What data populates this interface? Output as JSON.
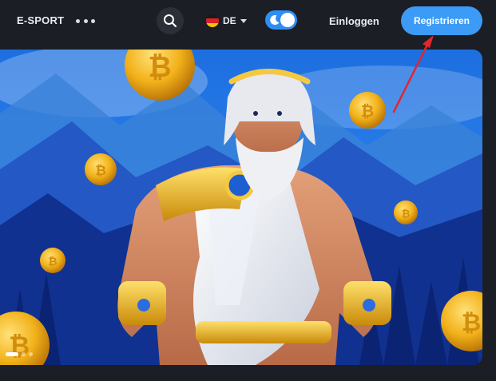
{
  "header": {
    "nav_label": "E-SPORT",
    "more_icon": "more-dots-icon",
    "search_icon": "search-icon",
    "language": {
      "code": "DE",
      "flag": "germany-flag-icon"
    },
    "theme_toggle": {
      "icon": "moon-icon",
      "state": "on"
    },
    "login_label": "Einloggen",
    "register_label": "Registrieren"
  },
  "banner": {
    "image": "zeus-with-gold-coins",
    "slides_total": 3,
    "active_slide": 1
  },
  "annotation": {
    "icon": "red-arrow-icon",
    "color": "#e0262e"
  },
  "colors": {
    "background": "#1b1e25",
    "accent": "#3b9bf7",
    "toggle": "#2f8ef2"
  }
}
